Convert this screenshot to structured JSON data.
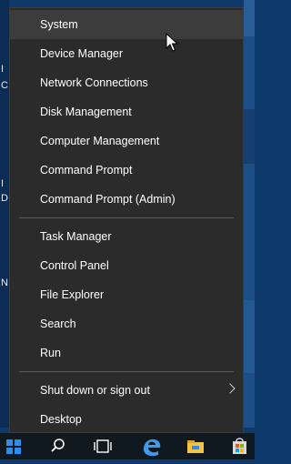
{
  "desktop": {
    "left_glyphs": [
      "I",
      "C",
      "I",
      "D",
      "N"
    ]
  },
  "menu": {
    "items": [
      {
        "label": "System"
      },
      {
        "label": "Device Manager"
      },
      {
        "label": "Network Connections"
      },
      {
        "label": "Disk Management"
      },
      {
        "label": "Computer Management"
      },
      {
        "label": "Command Prompt"
      },
      {
        "label": "Command Prompt (Admin)"
      },
      {
        "label": "Task Manager"
      },
      {
        "label": "Control Panel"
      },
      {
        "label": "File Explorer"
      },
      {
        "label": "Search"
      },
      {
        "label": "Run"
      },
      {
        "label": "Shut down or sign out"
      },
      {
        "label": "Desktop"
      }
    ],
    "hovered_item": "System"
  },
  "taskbar": {
    "icons": [
      "windows-logo-icon",
      "search-icon",
      "task-view-icon",
      "edge-icon",
      "file-explorer-icon",
      "store-icon"
    ]
  },
  "colors": {
    "menu_bg": "#2b2b2b",
    "menu_hover": "#3c3c3c",
    "text": "#ffffff",
    "accent": "#2b8df0"
  }
}
